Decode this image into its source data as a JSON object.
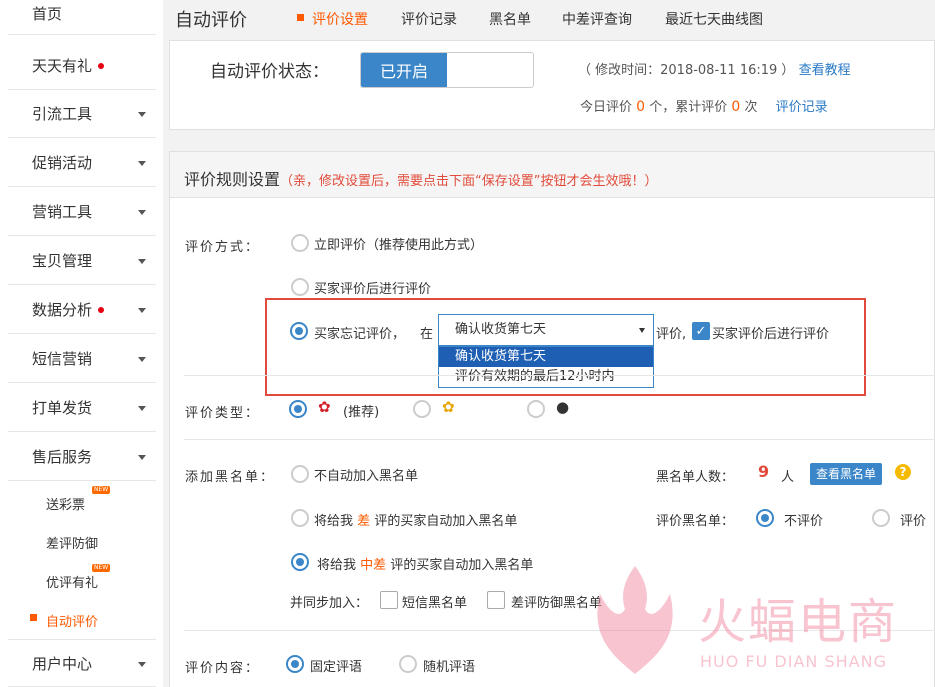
{
  "sidebar": {
    "items": [
      {
        "label": "首页",
        "dot": false,
        "caret": false
      },
      {
        "label": "天天有礼",
        "dot": true,
        "caret": false
      },
      {
        "label": "引流工具",
        "dot": false,
        "caret": true
      },
      {
        "label": "促销活动",
        "dot": false,
        "caret": true
      },
      {
        "label": "营销工具",
        "dot": false,
        "caret": true
      },
      {
        "label": "宝贝管理",
        "dot": false,
        "caret": true
      },
      {
        "label": "数据分析",
        "dot": true,
        "caret": true
      },
      {
        "label": "短信营销",
        "dot": false,
        "caret": true
      },
      {
        "label": "打单发货",
        "dot": false,
        "caret": true
      },
      {
        "label": "售后服务",
        "dot": false,
        "caret": true
      }
    ],
    "subitems": [
      {
        "label": "送彩票",
        "badge": "NEW"
      },
      {
        "label": "差评防御",
        "badge": ""
      },
      {
        "label": "优评有礼",
        "badge": "NEW"
      },
      {
        "label": "自动评价",
        "badge": ""
      }
    ],
    "footer_item": "用户中心"
  },
  "header": {
    "title": "自动评价",
    "tabs": [
      "评价设置",
      "评价记录",
      "黑名单",
      "中差评查询",
      "最近七天曲线图"
    ],
    "active_tab": "评价设置"
  },
  "status": {
    "label": "自动评价状态：",
    "toggle_on": "已开启",
    "modtime": "（ 修改时间：2018-08-11 16:19 ）",
    "tutorial_link": "查看教程",
    "today_prefix": "今日评价",
    "today_count": "0",
    "today_mid": "个，累计评价",
    "total_count": "0",
    "today_suffix": "次",
    "record_link": "评价记录"
  },
  "rules": {
    "title": "评价规则设置",
    "note": "（亲，修改设置后，需要点击下面“保存设置”按钮才会生效哦！）",
    "method_label": "评价方式：",
    "method_opt1": "立即评价（推荐使用此方式）",
    "method_opt2": "买家评价后进行评价",
    "method_opt3_prefix": "买家忘记评价，",
    "method_opt3_at": "在",
    "select_value": "确认收货第七天",
    "dropdown_options": [
      "确认收货第七天",
      "评价有效期的最后12小时内"
    ],
    "method_opt3_suffix": "评价,",
    "method_opt3_check": "买家评价后进行评价",
    "type_label": "评价类型：",
    "type_recommend": "(推荐)",
    "blacklist_label": "添加黑名单：",
    "bl_opt1": "不自动加入黑名单",
    "bl_opt2_a": "将给我",
    "bl_opt2_b": "差",
    "bl_opt2_c": "评的买家自动加入黑名单",
    "bl_opt3_a": "将给我",
    "bl_opt3_b": "中差",
    "bl_opt3_c": "评的买家自动加入黑名单",
    "sync_label": "并同步加入：",
    "sync_sms": "短信黑名单",
    "sync_defense": "差评防御黑名单",
    "bl_count_label": "黑名单人数：",
    "bl_count": "9",
    "bl_count_unit": "人",
    "view_bl_button": "查看黑名单",
    "help": "?",
    "bl_eval_label": "评价黑名单：",
    "bl_eval_opt1": "不评价",
    "bl_eval_opt2": "评价",
    "content_label": "评价内容：",
    "content_opt1": "固定评语",
    "content_opt2": "随机评语"
  },
  "watermark": {
    "text": "火蝠电商",
    "sub": "HUO FU DIAN SHANG"
  }
}
